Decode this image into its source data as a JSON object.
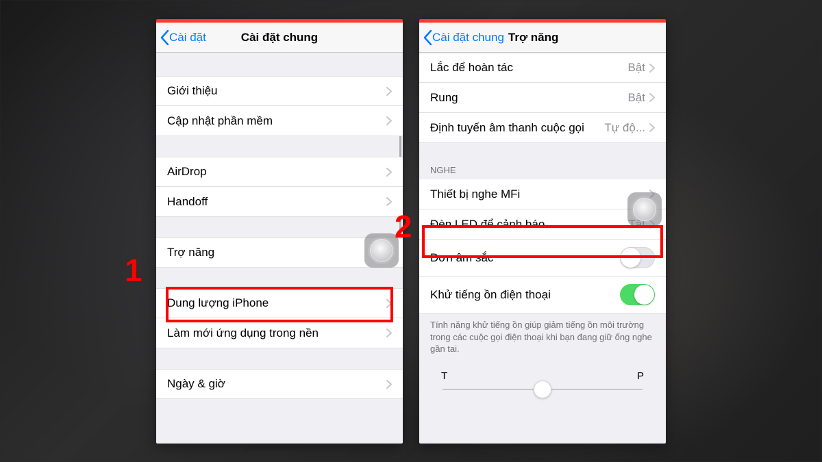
{
  "annotations": {
    "step1": "1",
    "step2": "2"
  },
  "screen1": {
    "back": "Cài đặt",
    "title": "Cài đặt chung",
    "g1": {
      "intro": "Giới thiệu",
      "update": "Cập nhật phần mềm"
    },
    "g2": {
      "airdrop": "AirDrop",
      "handoff": "Handoff"
    },
    "g3": {
      "accessibility": "Trợ năng"
    },
    "g4": {
      "storage": "Dung lượng iPhone",
      "bgrefresh": "Làm mới ứng dụng trong nền"
    },
    "g5": {
      "datetime": "Ngày & giờ"
    }
  },
  "screen2": {
    "back": "Cài đặt chung",
    "title": "Trợ năng",
    "top": {
      "shake": {
        "label": "Lắc để hoàn tác",
        "value": "Bật"
      },
      "vibration": {
        "label": "Rung",
        "value": "Bật"
      },
      "routing": {
        "label": "Định tuyến âm thanh cuộc gọi",
        "value": "Tự độ..."
      }
    },
    "hearing_header": "NGHE",
    "hearing": {
      "mfi": "Thiết bị nghe MFi",
      "led": {
        "label": "Đèn LED để cảnh báo",
        "value": "Tắt"
      },
      "mono": "Đơn âm sắc",
      "noise": "Khử tiếng ồn điện thoại"
    },
    "noise_note": "Tính năng khử tiếng ồn giúp giảm tiếng ồn môi trường trong các cuộc gọi điện thoại khi bạn đang giữ ống nghe gần tai.",
    "balance": {
      "left": "T",
      "right": "P"
    }
  }
}
